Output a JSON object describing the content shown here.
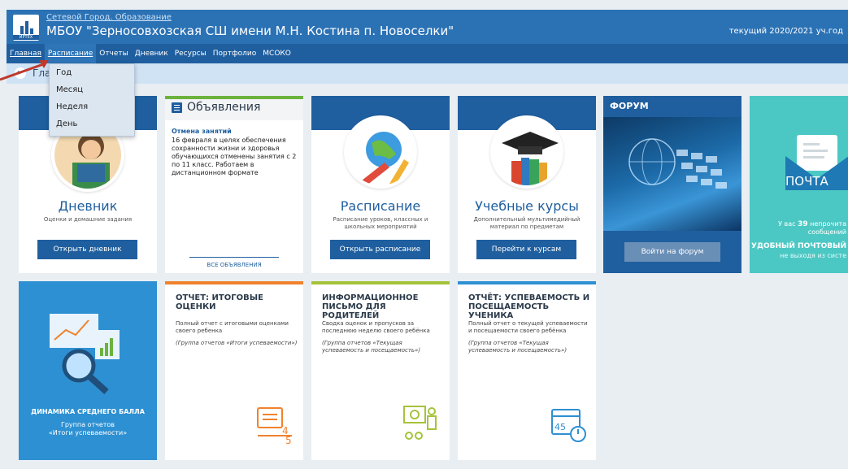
{
  "header": {
    "logo_label": "ИРТЕХ",
    "brand": "Сетевой Город. Образование",
    "school": "МБОУ \"Зерносовхозская СШ имени М.Н. Костина п. Новоселки\"",
    "year": "текущий 2020/2021 уч.год"
  },
  "nav": {
    "items": [
      "Главная",
      "Расписание",
      "Отчеты",
      "Дневник",
      "Ресурсы",
      "Портфолио",
      "МСОКО"
    ],
    "active": "Расписание"
  },
  "breadcrumb": {
    "title": "Главная"
  },
  "dropdown": {
    "items": [
      "Год",
      "Месяц",
      "Неделя",
      "День"
    ]
  },
  "cards": {
    "diary": {
      "title": "Дневник",
      "sub": "Оценки и домашние задания",
      "button": "Открыть дневник"
    },
    "announcements": {
      "title": "Объявления",
      "news_title": "Отмена занятий",
      "news_body": "16 февраля в целях обеспечения сохранности жизни и здоровья обучающихся отменены занятия с 2 по 11 класс. Работаем в дистанционном формате",
      "all_link": "ВСЕ ОБЪЯВЛЕНИЯ"
    },
    "schedule": {
      "title": "Расписание",
      "sub": "Расписание уроков, классных и школьных мероприятий",
      "button": "Открыть расписание"
    },
    "courses": {
      "title": "Учебные курсы",
      "sub": "Дополнительный мультимедийный материал по предметам",
      "button": "Перейти к курсам"
    },
    "forum": {
      "label": "ФОРУМ",
      "button": "Войти на форум"
    },
    "mail": {
      "word": "ПОЧТА",
      "unread_prefix": "У вас",
      "unread_count": "39",
      "unread_suffix": "непрочита",
      "unread_line2": "сообщений",
      "convenient": "УДОБНЫЙ ПОЧТОВЫЙ",
      "convenient2": "не выходя из систе"
    },
    "dynamics": {
      "title": "ДИНАМИКА СРЕДНЕГО БАЛЛА",
      "sub1": "Группа отчетов",
      "sub2": "«Итоги успеваемости»"
    },
    "report_final": {
      "title": "ОТЧЕТ: ИТОГОВЫЕ ОЦЕНКИ",
      "desc": "Полный отчет с итоговыми оценками своего ребенка",
      "group": "(Группа отчетов «Итоги успеваемости»)",
      "bar_color": "#f0822d"
    },
    "report_parents": {
      "title": "ИНФОРМАЦИОННОЕ ПИСЬМО ДЛЯ РОДИТЕЛЕЙ",
      "desc": "Сводка оценок и пропусков за последнюю неделю своего ребёнка",
      "group": "(Группа отчетов «Текущая успеваемость и посещаемость»)",
      "bar_color": "#a5c33a"
    },
    "report_attendance": {
      "title": "ОТЧЁТ: УСПЕВАЕМОСТЬ И ПОСЕЩАЕМОСТЬ УЧЕНИКА",
      "desc": "Полный отчет о текущей успеваемости и посещаемости своего ребёнка",
      "group": "(Группа отчетов «Текущая успеваемость и посещаемость»)",
      "bar_color": "#2d90d2"
    }
  },
  "colors": {
    "header": "#2b72b5",
    "nav": "#1f5f9f",
    "accent_green": "#6cb33e",
    "mail": "#4cc8c4"
  }
}
